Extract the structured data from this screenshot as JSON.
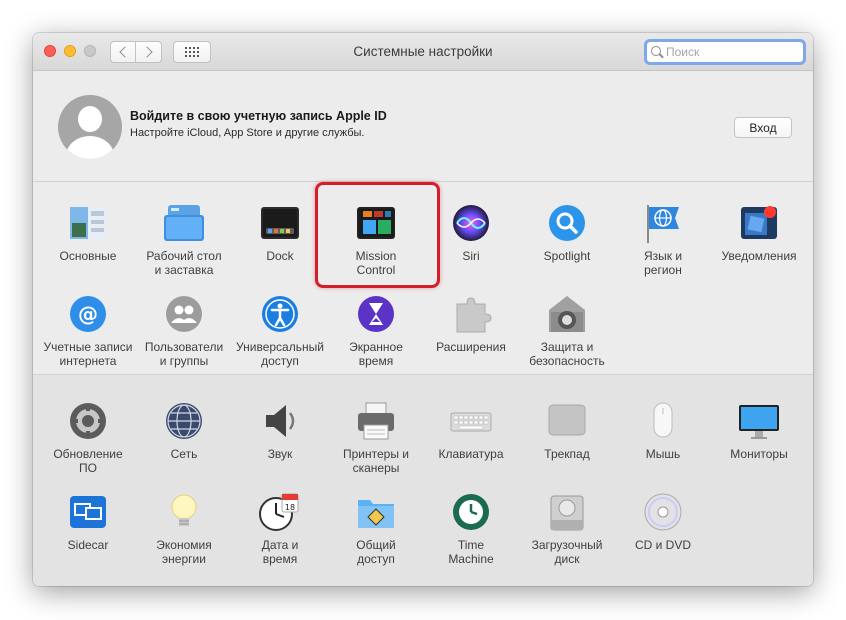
{
  "window": {
    "title": "Системные настройки"
  },
  "search": {
    "placeholder": "Поиск",
    "value": ""
  },
  "account": {
    "title": "Войдите в свою учетную запись Apple ID",
    "subtitle": "Настройте iCloud, App Store и другие службы.",
    "login_label": "Вход"
  },
  "highlight": {
    "item": "Mission Control",
    "color": "#d31f2a"
  },
  "section1": [
    {
      "label": "Основные",
      "icon": "general-icon"
    },
    {
      "label": "Рабочий стол\nи заставка",
      "icon": "desktop-screensaver-icon"
    },
    {
      "label": "Dock",
      "icon": "dock-icon"
    },
    {
      "label": "Mission\nControl",
      "icon": "mission-control-icon"
    },
    {
      "label": "Siri",
      "icon": "siri-icon"
    },
    {
      "label": "Spotlight",
      "icon": "spotlight-icon"
    },
    {
      "label": "Язык и\nрегион",
      "icon": "language-region-icon"
    },
    {
      "label": "Уведомления",
      "icon": "notifications-icon"
    },
    {
      "label": "Учетные записи\nинтернета",
      "icon": "internet-accounts-icon"
    },
    {
      "label": "Пользователи\nи группы",
      "icon": "users-groups-icon"
    },
    {
      "label": "Универсальный\nдоступ",
      "icon": "accessibility-icon"
    },
    {
      "label": "Экранное\nвремя",
      "icon": "screen-time-icon"
    },
    {
      "label": "Расширения",
      "icon": "extensions-icon"
    },
    {
      "label": "Защита и\nбезопасность",
      "icon": "security-privacy-icon"
    }
  ],
  "section2": [
    {
      "label": "Обновление\nПО",
      "icon": "software-update-icon"
    },
    {
      "label": "Сеть",
      "icon": "network-icon"
    },
    {
      "label": "Звук",
      "icon": "sound-icon"
    },
    {
      "label": "Принтеры и\nсканеры",
      "icon": "printers-scanners-icon"
    },
    {
      "label": "Клавиатура",
      "icon": "keyboard-icon"
    },
    {
      "label": "Трекпад",
      "icon": "trackpad-icon"
    },
    {
      "label": "Мышь",
      "icon": "mouse-icon"
    },
    {
      "label": "Мониторы",
      "icon": "displays-icon"
    },
    {
      "label": "Sidecar",
      "icon": "sidecar-icon"
    },
    {
      "label": "Экономия\nэнергии",
      "icon": "energy-saver-icon"
    },
    {
      "label": "Дата и\nвремя",
      "icon": "date-time-icon"
    },
    {
      "label": "Общий\nдоступ",
      "icon": "sharing-icon"
    },
    {
      "label": "Time\nMachine",
      "icon": "time-machine-icon"
    },
    {
      "label": "Загрузочный\nдиск",
      "icon": "startup-disk-icon"
    },
    {
      "label": "CD и DVD",
      "icon": "cd-dvd-icon"
    }
  ]
}
